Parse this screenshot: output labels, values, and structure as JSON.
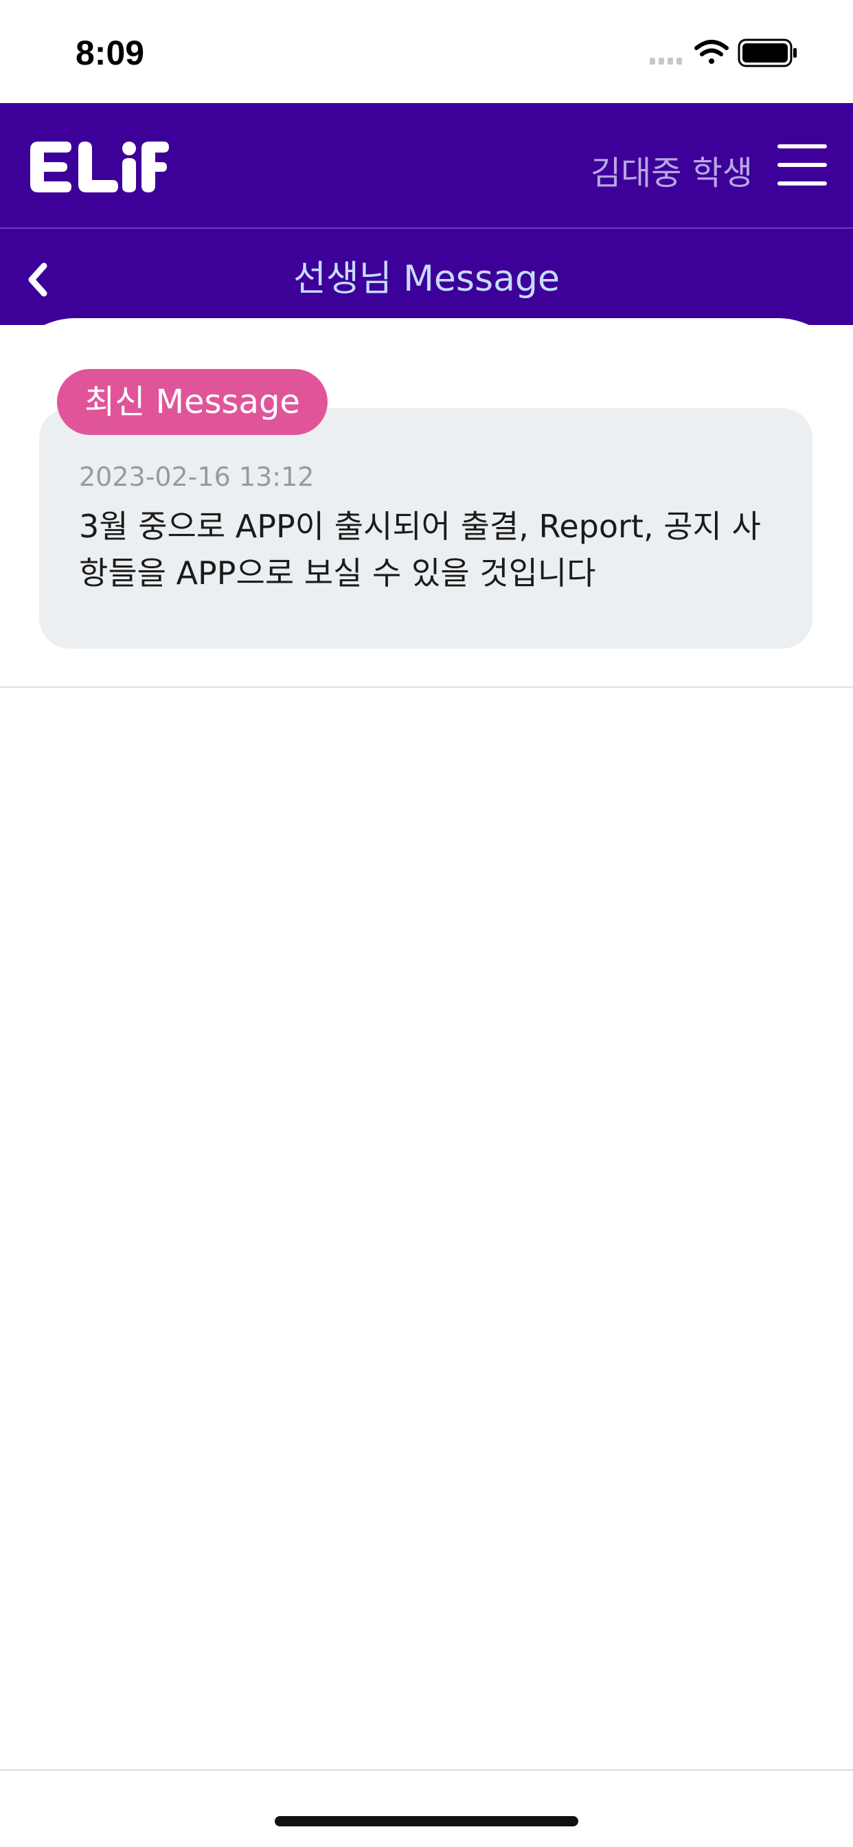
{
  "status_bar": {
    "time": "8:09",
    "icons": [
      "signal-icon",
      "wifi-icon",
      "battery-icon"
    ]
  },
  "header": {
    "logo_text": "ELiF",
    "user_name": "김대중 학생",
    "menu_icon": "hamburger-menu-icon"
  },
  "subheader": {
    "back_icon": "chevron-left-icon",
    "title": "선생님 Message"
  },
  "messages": {
    "badge": "최신 Message",
    "latest": {
      "date": "2023-02-16 13:12",
      "text": "3월 중으로 APP이 출시되어 출결, Report, 공지 사항들을 APP으로 보실 수 있을 것입니다"
    }
  },
  "colors": {
    "header_bg": "#3d0099",
    "badge_bg": "#e0559a",
    "card_bg": "#eceff1",
    "title_color": "#c6dcff"
  }
}
